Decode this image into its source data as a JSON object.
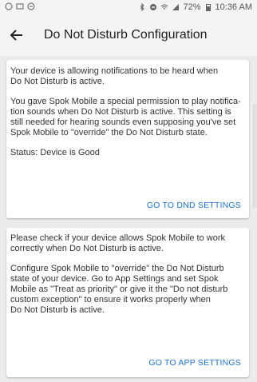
{
  "status_bar": {
    "battery": "72%",
    "time": "10:36 AM"
  },
  "header": {
    "title": "Do Not Disturb Configuration"
  },
  "card_dnd": {
    "line1": "Your device is allowing notifications to be heard when",
    "line2": "Do Not Disturb is active.",
    "p2l1": "You gave Spok Mobile a special permission to play notifica-",
    "p2l2": "tion sounds when Do Not Disturb is active. This setting is",
    "p2l3": "still needed for hearing sounds even supposing you've set",
    "p2l4": "Spok Mobile to \"override\" the Do Not Disturb state.",
    "status": "Status: Device is Good",
    "action": "GO TO DND SETTINGS"
  },
  "card_app": {
    "p1l1": "Please check if your device allows Spok Mobile to work",
    "p1l2": "correctly when Do Not Disturb is active.",
    "p2l1": "Configure Spok Mobile to \"override\" the Do Not Disturb",
    "p2l2": "state of your device. Go to App Settings and set Spok",
    "p2l3": "Mobile as \"Treat as priority\" or give it the \"Do not disturb",
    "p2l4": "custom exception\" to ensure it works properly when",
    "p2l5": "Do Not Disturb is active.",
    "action": "GO TO APP SETTINGS"
  }
}
